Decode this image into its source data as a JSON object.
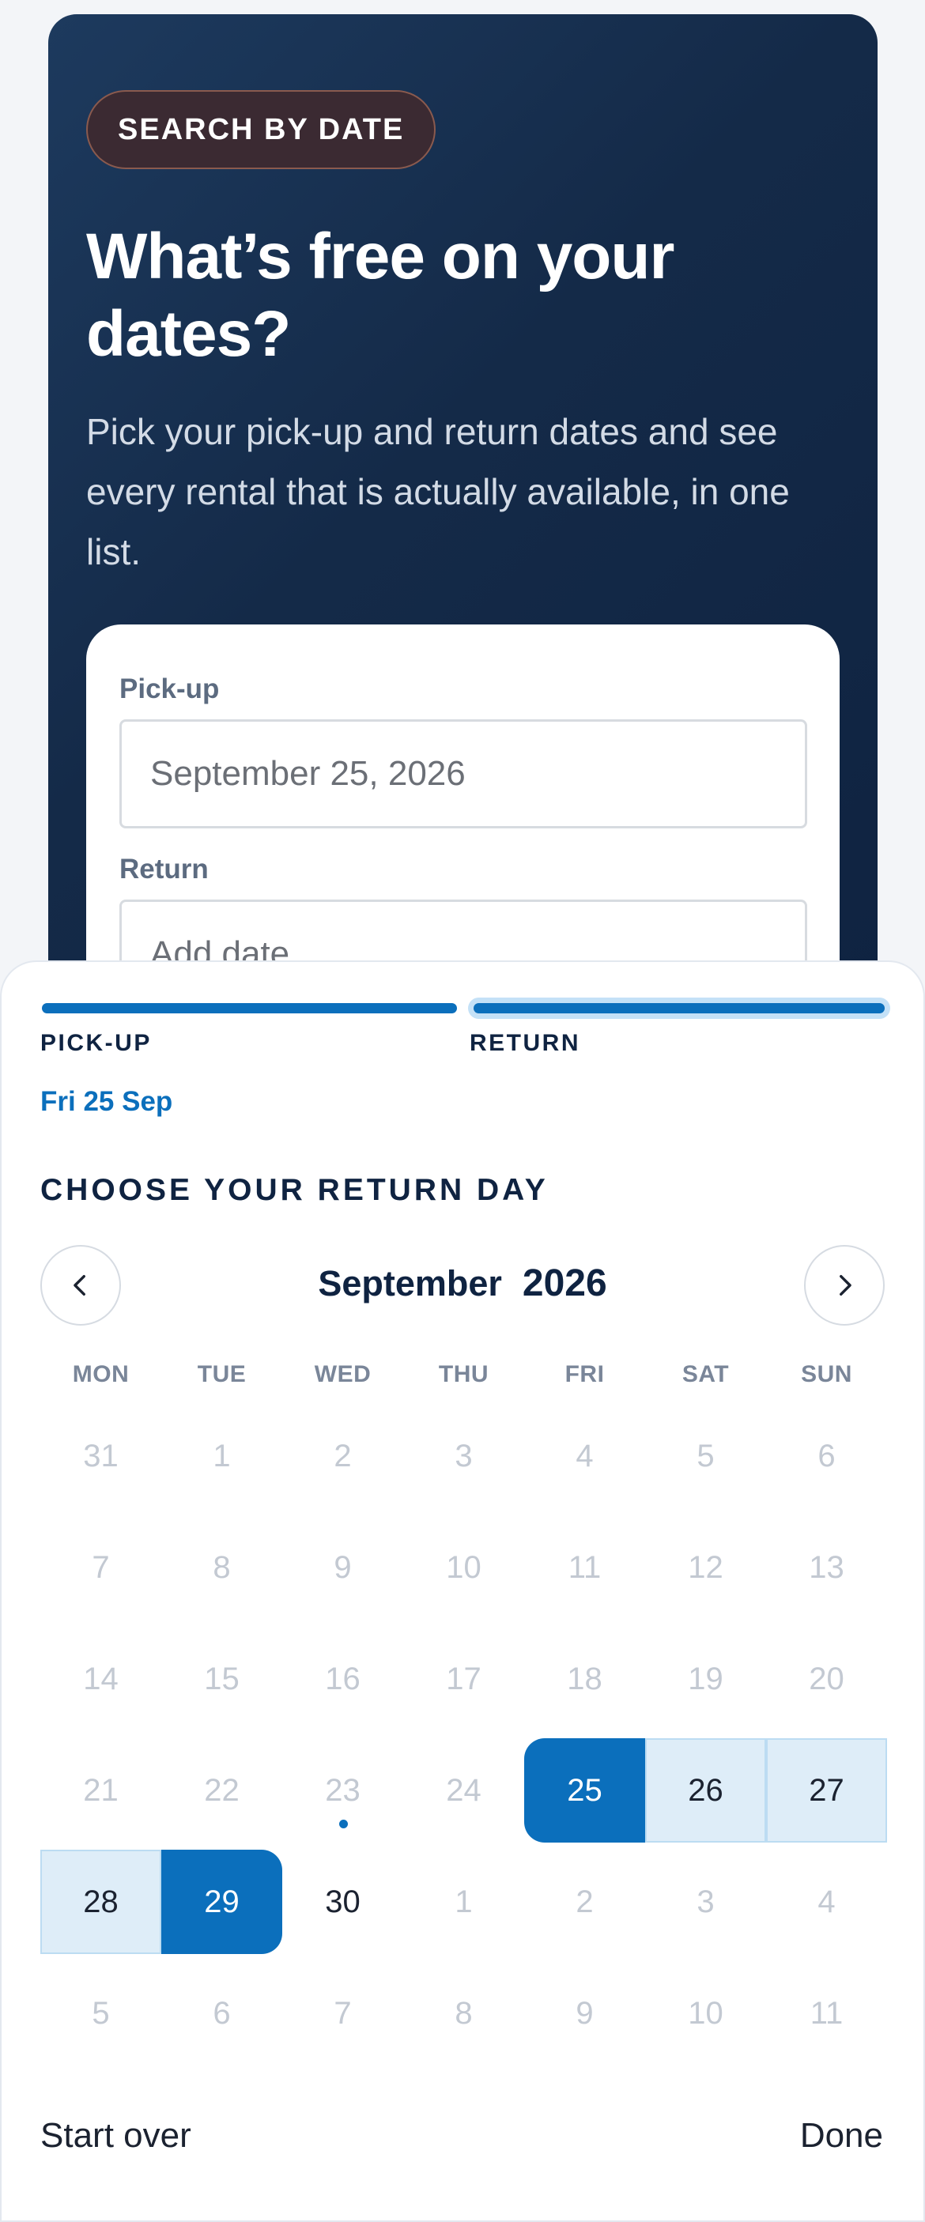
{
  "hero": {
    "badge": "SEARCH BY DATE",
    "title": "What’s free on your dates?",
    "subtitle": "Pick your pick-up and return dates and see every rental that is actually available, in one list."
  },
  "form": {
    "pickup_label": "Pick-up",
    "pickup_value": "September 25, 2026",
    "return_label": "Return",
    "return_placeholder": "Add date"
  },
  "picker": {
    "steps": [
      {
        "label": "PICK-UP",
        "value": "Fri 25 Sep"
      },
      {
        "label": "RETURN",
        "value": ""
      }
    ],
    "section_title": "CHOOSE YOUR RETURN DAY",
    "month": "September",
    "year": "2026",
    "weekdays": [
      "MON",
      "TUE",
      "WED",
      "THU",
      "FRI",
      "SAT",
      "SUN"
    ],
    "weeks": [
      [
        {
          "d": "31",
          "s": "muted"
        },
        {
          "d": "1",
          "s": "muted"
        },
        {
          "d": "2",
          "s": "muted"
        },
        {
          "d": "3",
          "s": "muted"
        },
        {
          "d": "4",
          "s": "muted"
        },
        {
          "d": "5",
          "s": "muted"
        },
        {
          "d": "6",
          "s": "muted"
        }
      ],
      [
        {
          "d": "7",
          "s": "muted"
        },
        {
          "d": "8",
          "s": "muted"
        },
        {
          "d": "9",
          "s": "muted"
        },
        {
          "d": "10",
          "s": "muted"
        },
        {
          "d": "11",
          "s": "muted"
        },
        {
          "d": "12",
          "s": "muted"
        },
        {
          "d": "13",
          "s": "muted"
        }
      ],
      [
        {
          "d": "14",
          "s": "muted"
        },
        {
          "d": "15",
          "s": "muted"
        },
        {
          "d": "16",
          "s": "muted"
        },
        {
          "d": "17",
          "s": "muted"
        },
        {
          "d": "18",
          "s": "muted"
        },
        {
          "d": "19",
          "s": "muted"
        },
        {
          "d": "20",
          "s": "muted"
        }
      ],
      [
        {
          "d": "21",
          "s": "muted"
        },
        {
          "d": "22",
          "s": "muted"
        },
        {
          "d": "23",
          "s": "muted",
          "today": true
        },
        {
          "d": "24",
          "s": "muted"
        },
        {
          "d": "25",
          "s": "selected-start"
        },
        {
          "d": "26",
          "s": "range"
        },
        {
          "d": "27",
          "s": "range"
        }
      ],
      [
        {
          "d": "28",
          "s": "range"
        },
        {
          "d": "29",
          "s": "selected-end"
        },
        {
          "d": "30",
          "s": "available"
        },
        {
          "d": "1",
          "s": "muted"
        },
        {
          "d": "2",
          "s": "muted"
        },
        {
          "d": "3",
          "s": "muted"
        },
        {
          "d": "4",
          "s": "muted"
        }
      ],
      [
        {
          "d": "5",
          "s": "muted"
        },
        {
          "d": "6",
          "s": "muted"
        },
        {
          "d": "7",
          "s": "muted"
        },
        {
          "d": "8",
          "s": "muted"
        },
        {
          "d": "9",
          "s": "muted"
        },
        {
          "d": "10",
          "s": "muted"
        },
        {
          "d": "11",
          "s": "muted"
        }
      ]
    ],
    "prev_icon": "chevron-left-icon",
    "next_icon": "chevron-right-icon",
    "start_over_label": "Start over",
    "done_label": "Done"
  },
  "colors": {
    "accent": "#0b6fbc",
    "range_fill": "#deedf8",
    "hero_bg": "#142a48",
    "badge_bg": "#3b2a32"
  }
}
